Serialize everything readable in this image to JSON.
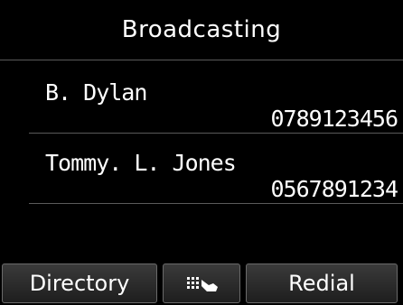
{
  "header": {
    "title": "Broadcasting"
  },
  "recipients": [
    {
      "name": "B. Dylan",
      "number": "0789123456"
    },
    {
      "name": "Tommy. L. Jones",
      "number": "0567891234"
    }
  ],
  "buttons": {
    "directory_label": "Directory",
    "tone_icon": "touch-tone-icon",
    "redial_label": "Redial"
  },
  "colors": {
    "background": "#000000",
    "text": "#ffffff",
    "divider": "#5a5a5a"
  }
}
